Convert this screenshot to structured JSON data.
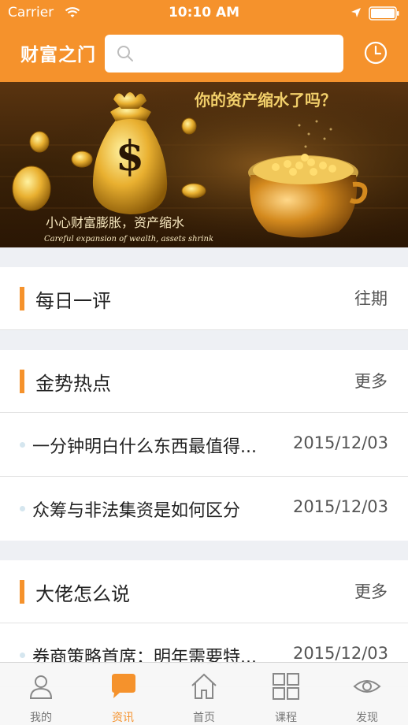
{
  "status": {
    "carrier": "Carrier",
    "time": "10:10 AM"
  },
  "header": {
    "title": "财富之门",
    "search_placeholder": "",
    "icons": [
      "search-icon",
      "clock-icon"
    ]
  },
  "banner": {
    "headline": "你的资产缩水了吗？",
    "caption_cn": "小心财富膨胀，资产缩水",
    "caption_en": "Careful expansion of wealth, assets shrink"
  },
  "sections": [
    {
      "title": "每日一评",
      "more": "往期",
      "items": []
    },
    {
      "title": "金势热点",
      "more": "更多",
      "items": [
        {
          "title": "一分钟明白什么东西最值得...",
          "date": "2015/12/03"
        },
        {
          "title": "众筹与非法集资是如何区分",
          "date": "2015/12/03"
        }
      ]
    },
    {
      "title": "大佬怎么说",
      "more": "更多",
      "items": [
        {
          "title": "券商策略首席：明年需要特...",
          "date": "2015/12/03"
        }
      ]
    }
  ],
  "tabbar": {
    "active": "资讯",
    "accent": "#f5922c",
    "tabs": [
      {
        "label": "我的",
        "icon": "user-icon"
      },
      {
        "label": "资讯",
        "icon": "chat-icon"
      },
      {
        "label": "首页",
        "icon": "home-icon"
      },
      {
        "label": "课程",
        "icon": "grid-icon"
      },
      {
        "label": "发现",
        "icon": "eye-icon"
      }
    ]
  }
}
